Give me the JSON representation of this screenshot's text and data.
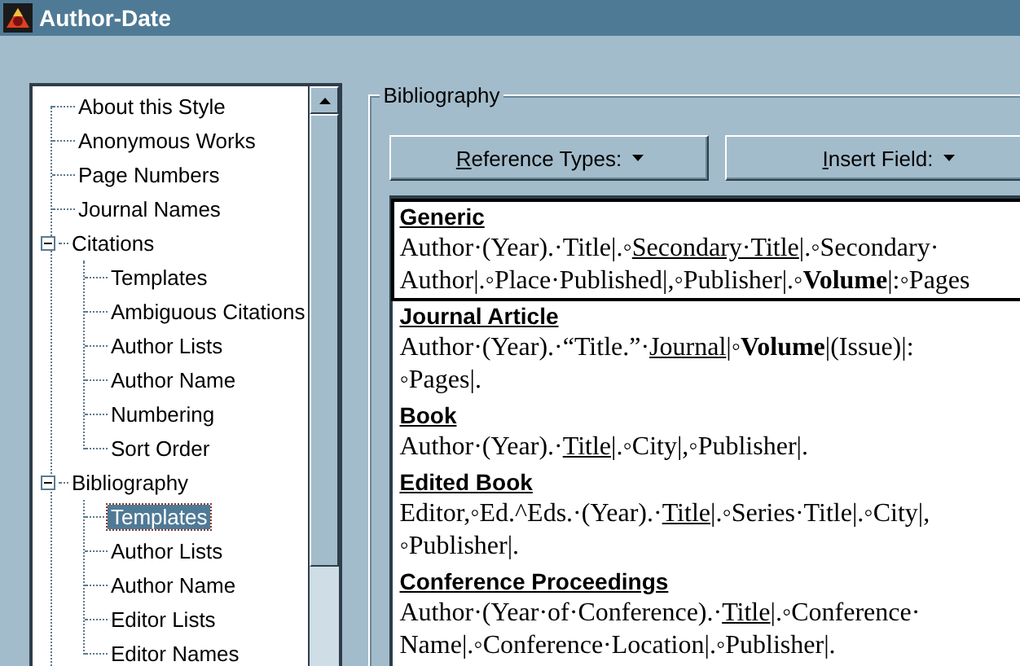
{
  "window": {
    "title": "Author-Date"
  },
  "tree": [
    {
      "label": "About this Style",
      "selected": false
    },
    {
      "label": "Anonymous Works",
      "selected": false
    },
    {
      "label": "Page Numbers",
      "selected": false
    },
    {
      "label": "Journal Names",
      "selected": false
    },
    {
      "label": "Citations",
      "selected": false,
      "expanded": true,
      "children": [
        {
          "label": "Templates",
          "selected": false
        },
        {
          "label": "Ambiguous Citations",
          "selected": false
        },
        {
          "label": "Author Lists",
          "selected": false
        },
        {
          "label": "Author Name",
          "selected": false
        },
        {
          "label": "Numbering",
          "selected": false
        },
        {
          "label": "Sort Order",
          "selected": false
        }
      ]
    },
    {
      "label": "Bibliography",
      "selected": false,
      "expanded": true,
      "children": [
        {
          "label": "Templates",
          "selected": true
        },
        {
          "label": "Author Lists",
          "selected": false
        },
        {
          "label": "Author Name",
          "selected": false
        },
        {
          "label": "Editor Lists",
          "selected": false
        },
        {
          "label": "Editor Names",
          "selected": false
        }
      ]
    }
  ],
  "group": {
    "title": "Bibliography"
  },
  "buttons": [
    {
      "label": "Reference Types:"
    },
    {
      "label": "Insert Field:"
    }
  ],
  "templates": [
    {
      "name": "Generic",
      "selected": true,
      "lines": [
        [
          {
            "kind": "plain",
            "text": "Author·(Year).·Title|.◦"
          },
          {
            "kind": "underline",
            "text": "Secondary·Title"
          },
          {
            "kind": "plain",
            "text": "|.◦Secondary·"
          }
        ],
        [
          {
            "kind": "plain",
            "text": "Author|.◦Place·Published|,◦Publisher|.◦"
          },
          {
            "kind": "bold",
            "text": "Volume"
          },
          {
            "kind": "plain",
            "text": "|:◦Pages"
          }
        ]
      ]
    },
    {
      "name": "Journal Article",
      "selected": false,
      "lines": [
        [
          {
            "kind": "plain",
            "text": "Author·(Year).·“Title.”·"
          },
          {
            "kind": "underline",
            "text": "Journal"
          },
          {
            "kind": "plain",
            "text": "|◦"
          },
          {
            "kind": "bold",
            "text": "Volume"
          },
          {
            "kind": "plain",
            "text": "|(Issue)|:"
          }
        ],
        [
          {
            "kind": "plain",
            "text": "◦Pages|."
          }
        ]
      ]
    },
    {
      "name": "Book",
      "selected": false,
      "lines": [
        [
          {
            "kind": "plain",
            "text": "Author·(Year).·"
          },
          {
            "kind": "underline",
            "text": "Title"
          },
          {
            "kind": "plain",
            "text": "|.◦City|,◦Publisher|."
          }
        ]
      ]
    },
    {
      "name": "Edited Book",
      "selected": false,
      "lines": [
        [
          {
            "kind": "plain",
            "text": "Editor,◦Ed.^Eds.·(Year).·"
          },
          {
            "kind": "underline",
            "text": "Title"
          },
          {
            "kind": "plain",
            "text": "|.◦Series·Title|.◦City|,"
          }
        ],
        [
          {
            "kind": "plain",
            "text": "◦Publisher|."
          }
        ]
      ]
    },
    {
      "name": "Conference Proceedings",
      "selected": false,
      "lines": [
        [
          {
            "kind": "plain",
            "text": "Author·(Year·of·Conference).·"
          },
          {
            "kind": "underline",
            "text": "Title"
          },
          {
            "kind": "plain",
            "text": "|.◦Conference·"
          }
        ],
        [
          {
            "kind": "plain",
            "text": "Name|.◦Conference·Location|.◦Publisher|."
          }
        ]
      ]
    }
  ]
}
